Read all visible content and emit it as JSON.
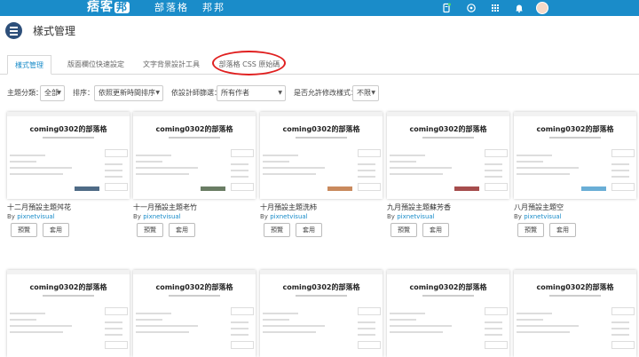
{
  "topbar": {
    "logo_text": "痞客",
    "logo_badge": "邦",
    "nav_items": [
      "部落格",
      "邦邦"
    ],
    "icons": [
      "document-icon",
      "search-icon",
      "apps-grid-icon",
      "bell-icon",
      "avatar"
    ],
    "color": "#1a8cc9"
  },
  "page": {
    "title": "樣式管理"
  },
  "tabs": [
    {
      "label": "樣式管理",
      "active": true
    },
    {
      "label": "版面欄位快速設定",
      "active": false
    },
    {
      "label": "文字背景設計工具",
      "active": false
    },
    {
      "label": "部落格 CSS 原始碼",
      "active": false,
      "highlighted": true
    }
  ],
  "filters": {
    "category_label": "主題分類：",
    "category_value": "全部",
    "sort_label": "排序：",
    "sort_value": "依照更新時間排序",
    "designer_label": "依設計師篩選：",
    "designer_value": "所有作者",
    "editable_label": "是否允許修改樣式：",
    "editable_value": "不限"
  },
  "card_common": {
    "preview_title": "coming0302的部落格",
    "by_label": "By",
    "preview_button": "預覽",
    "apply_button": "套用"
  },
  "themes": [
    {
      "name": "十二月預設主題舛花",
      "author": "pixnetvisual",
      "accent": "#4f6b86"
    },
    {
      "name": "十一月預設主題老竹",
      "author": "pixnetvisual",
      "accent": "#6a7d64"
    },
    {
      "name": "十月預設主題洗柿",
      "author": "pixnetvisual",
      "accent": "#c98a5d"
    },
    {
      "name": "九月預設主題蘇芳香",
      "author": "pixnetvisual",
      "accent": "#a64d4d"
    },
    {
      "name": "八月預設主題空",
      "author": "pixnetvisual",
      "accent": "#6aaed6"
    }
  ]
}
